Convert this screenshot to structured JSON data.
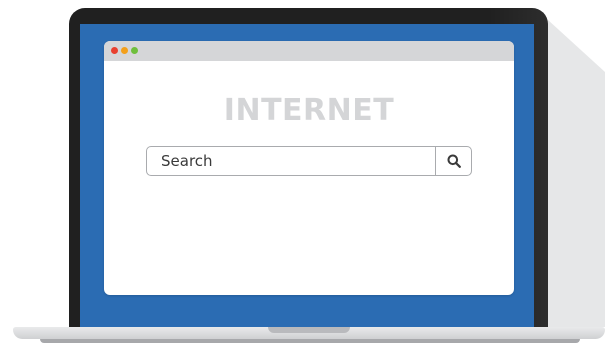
{
  "browser": {
    "page_title": "INTERNET",
    "search": {
      "value": "",
      "placeholder": "Search",
      "button_icon": "search-icon"
    }
  },
  "colors": {
    "screen_bezel": "#2b6cb3",
    "laptop_body": "#202020",
    "titlebar": "#d5d6d8",
    "title_text": "#d4d5d7",
    "window_dots": [
      "#e8402f",
      "#f3a01b",
      "#6fbf3c"
    ]
  }
}
